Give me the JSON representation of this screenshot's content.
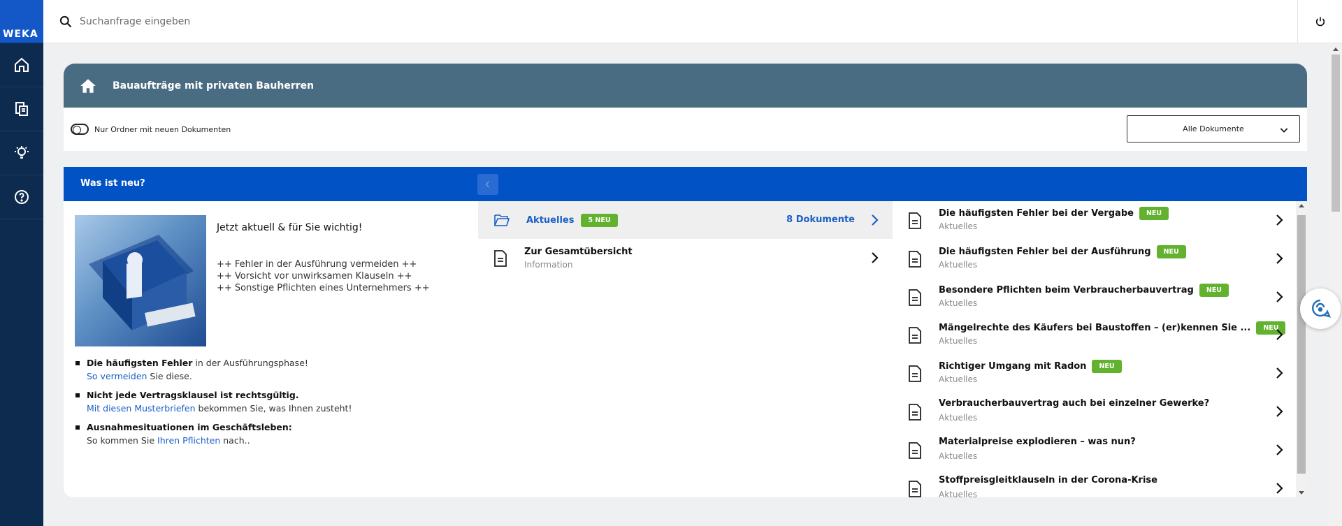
{
  "app": {
    "logo_text": "WEKA"
  },
  "search": {
    "placeholder": "Suchanfrage eingeben"
  },
  "nav": {
    "items": [
      "home-icon",
      "documents-icon",
      "idea-icon",
      "help-icon"
    ]
  },
  "header": {
    "title": "Bauaufträge mit privaten Bauherren"
  },
  "filter": {
    "toggle_label": "Nur Ordner mit neuen Dokumenten",
    "select_value": "Alle Dokumente"
  },
  "news": {
    "title": "Was ist neu?",
    "headline": "Jetzt aktuell & für Sie wichtig!",
    "lines": [
      "++ Fehler in der Ausführung vermeiden ++",
      "++ Vorsicht vor unwirksamen Klauseln ++",
      "++ Sonstige Pflichten eines Unternehmers ++"
    ],
    "bullets": [
      {
        "bold": "Die häufigsten Fehler",
        "rest": " in der Ausführungsphase!",
        "link": "So vermeiden",
        "tail": " Sie diese."
      },
      {
        "bold": "Nicht jede Vertragsklausel ist rechtsgültig.",
        "rest": "",
        "link": "Mit diesen Musterbriefen",
        "tail": " bekommen Sie, was Ihnen zusteht!"
      },
      {
        "bold": "Ausnahmesituationen im Geschäftsleben:",
        "rest": "",
        "pre": "So kommen Sie ",
        "link": "Ihren Pflichten",
        "tail": " nach.."
      }
    ]
  },
  "folders": {
    "active": {
      "label": "Aktuelles",
      "badge": "5 NEU",
      "count": "8 Dokumente"
    },
    "overview": {
      "title": "Zur Gesamtübersicht",
      "subtitle": "Information"
    }
  },
  "documents": [
    {
      "title": "Die häufigsten Fehler bei der Vergabe",
      "badge": "NEU",
      "category": "Aktuelles"
    },
    {
      "title": "Die häufigsten Fehler bei der Ausführung",
      "badge": "NEU",
      "category": "Aktuelles"
    },
    {
      "title": "Besondere Pflichten beim Verbraucherbauvertrag",
      "badge": "NEU",
      "category": "Aktuelles"
    },
    {
      "title": "Mängelrechte des Käufers bei Baustoffen – (er)kennen Sie ...",
      "badge": "NEU",
      "category": "Aktuelles"
    },
    {
      "title": "Richtiger Umgang mit Radon",
      "badge": "NEU",
      "category": "Aktuelles"
    },
    {
      "title": "Verbraucherbauvertrag auch bei einzelner Gewerke?",
      "badge": "",
      "category": "Aktuelles"
    },
    {
      "title": "Materialpreise explodieren – was nun?",
      "badge": "",
      "category": "Aktuelles"
    },
    {
      "title": "Stoffpreisgleitklauseln in der Corona-Krise",
      "badge": "",
      "category": "Aktuelles"
    }
  ],
  "colors": {
    "rail": "#0d2a4f",
    "brand": "#1458c8",
    "header": "#4a6c82",
    "news_bar": "#0152c4",
    "badge": "#62b22f",
    "link": "#1a5fc8"
  }
}
